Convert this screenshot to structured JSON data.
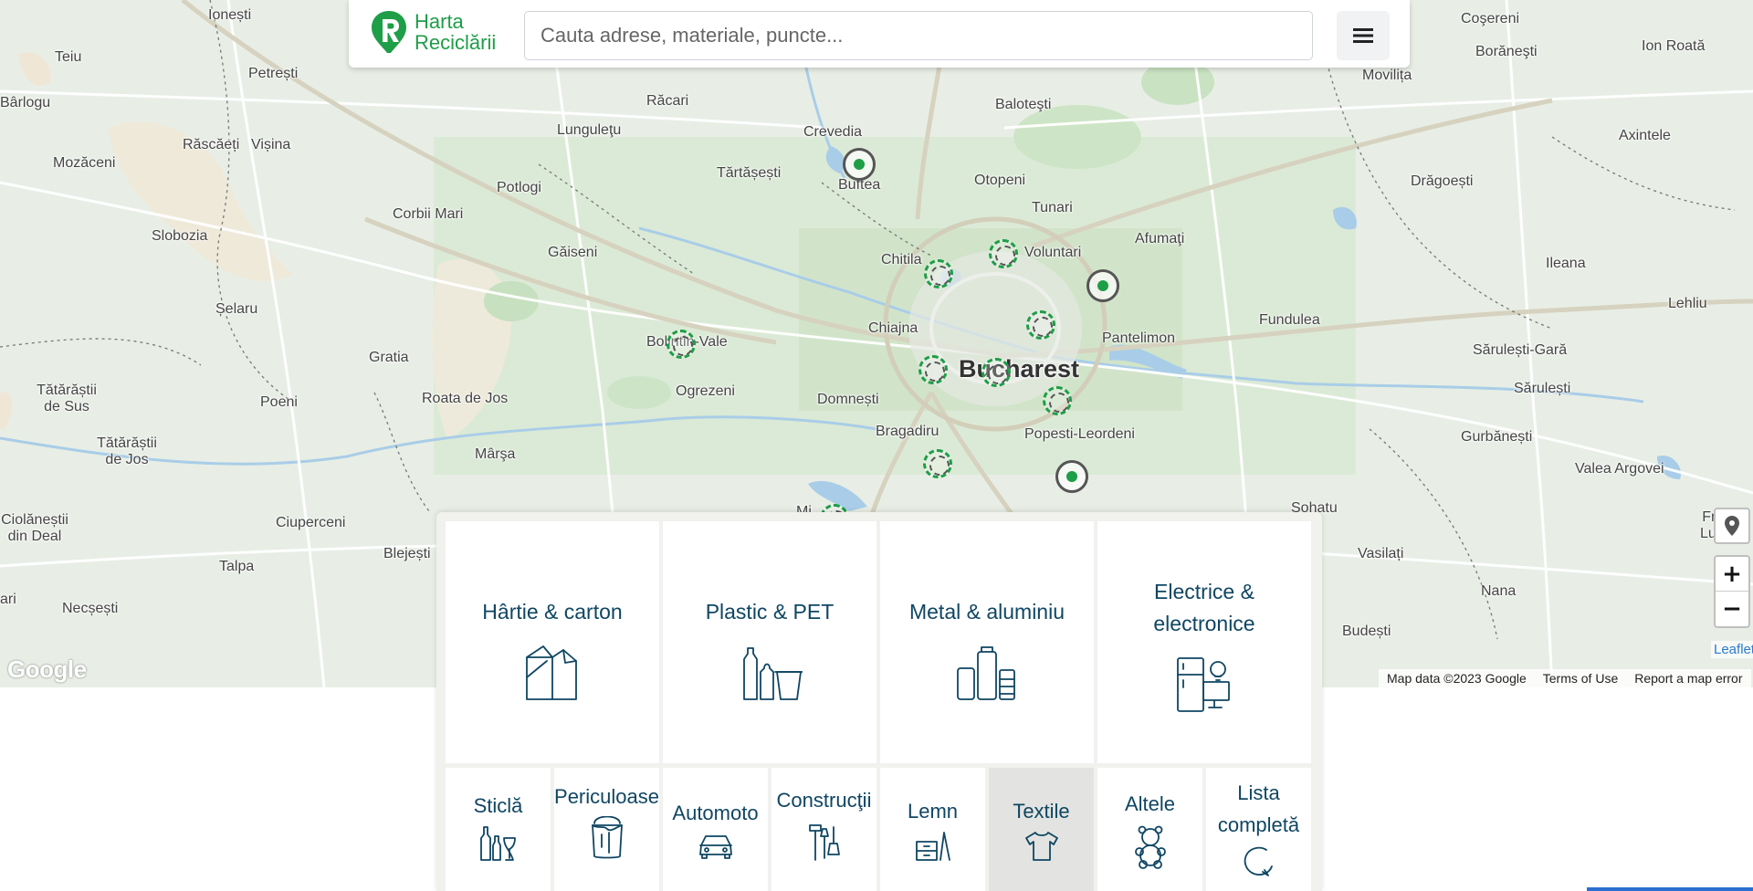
{
  "header": {
    "logo_line1": "Harta",
    "logo_line2": "Reciclării",
    "search_placeholder": "Cauta adrese, materiale, puncte...",
    "menu_icon": "hamburger-icon"
  },
  "map": {
    "places": [
      {
        "name": "Ionești"
      },
      {
        "name": "Teiu"
      },
      {
        "name": "Petrești"
      },
      {
        "name": "Bârlogu"
      },
      {
        "name": "Răscăeți"
      },
      {
        "name": "Vișina"
      },
      {
        "name": "Mozăceni"
      },
      {
        "name": "Slobozia"
      },
      {
        "name": "Corbii Mari"
      },
      {
        "name": "Potlogi"
      },
      {
        "name": "Lunguleţu"
      },
      {
        "name": "Răcari"
      },
      {
        "name": "Crevedia"
      },
      {
        "name": "Buftea"
      },
      {
        "name": "Tărtășești"
      },
      {
        "name": "Baloteşti"
      },
      {
        "name": "Otopeni"
      },
      {
        "name": "Tunari"
      },
      {
        "name": "Voluntari"
      },
      {
        "name": "Afumaţi"
      },
      {
        "name": "Găiseni"
      },
      {
        "name": "Chitila"
      },
      {
        "name": "Șelaru"
      },
      {
        "name": "Bolintin-Vale"
      },
      {
        "name": "Chiajna"
      },
      {
        "name": "Gratia"
      },
      {
        "name": "Pantelimon"
      },
      {
        "name": "Bucharest"
      },
      {
        "name": "Ogrezeni"
      },
      {
        "name": "Tătărăștii de Sus"
      },
      {
        "name": "Poeni"
      },
      {
        "name": "Roata de Jos"
      },
      {
        "name": "Domnești"
      },
      {
        "name": "Bragadiru"
      },
      {
        "name": "Popesti-Leordeni"
      },
      {
        "name": "Mârşa"
      },
      {
        "name": "Tătărăștii de Jos"
      },
      {
        "name": "Ciolăneștii din Deal"
      },
      {
        "name": "Ciuperceni"
      },
      {
        "name": "Blejești"
      },
      {
        "name": "Talpa"
      },
      {
        "name": "Necșești"
      },
      {
        "name": "Coşereni"
      },
      {
        "name": "Borăneşti"
      },
      {
        "name": "Ion Roată"
      },
      {
        "name": "Movilița"
      },
      {
        "name": "Axintele"
      },
      {
        "name": "Drăgoești"
      },
      {
        "name": "Ileana"
      },
      {
        "name": "Lehliu"
      },
      {
        "name": "Fundulea"
      },
      {
        "name": "Sărulești-Gară"
      },
      {
        "name": "Sărulești"
      },
      {
        "name": "Gurbănești"
      },
      {
        "name": "Valea Argovei"
      },
      {
        "name": "Frăsi Luptă"
      },
      {
        "name": "Sohatu"
      },
      {
        "name": "Vasilați"
      },
      {
        "name": "Nana"
      },
      {
        "name": "Budești"
      },
      {
        "name": "Mi"
      },
      {
        "name": "ari"
      }
    ],
    "locate_icon": "location-pin-icon",
    "zoom_in": "+",
    "zoom_out": "−",
    "leaflet_attr": "Leaflet",
    "google_logo": "Google",
    "map_data": "Map data ©2023 Google",
    "terms": "Terms of Use",
    "report": "Report a map error"
  },
  "categories": {
    "big": [
      {
        "label": "Hârtie & carton",
        "icon": "paper-carton-icon"
      },
      {
        "label": "Plastic & PET",
        "icon": "plastic-bottles-icon"
      },
      {
        "label": "Metal & aluminiu",
        "icon": "metal-cans-icon"
      },
      {
        "label": "Electrice & electronice",
        "icon": "electronics-icon"
      }
    ],
    "small": [
      {
        "label": "Sticlă",
        "icon": "glass-bottles-icon"
      },
      {
        "label": "Periculoase",
        "icon": "paint-bucket-icon"
      },
      {
        "label": "Automoto",
        "icon": "car-icon"
      },
      {
        "label": "Construcţii",
        "icon": "tools-icon"
      },
      {
        "label": "Lemn",
        "icon": "wood-furniture-icon"
      },
      {
        "label": "Textile",
        "icon": "tshirt-icon",
        "active": true
      },
      {
        "label": "Altele",
        "icon": "teddy-bear-icon"
      },
      {
        "label": "Lista completă",
        "icon": "refresh-icon"
      }
    ]
  },
  "colors": {
    "accent": "#1e9e47",
    "text_dark": "#0f4663",
    "marker_green": "#1e9e47"
  }
}
